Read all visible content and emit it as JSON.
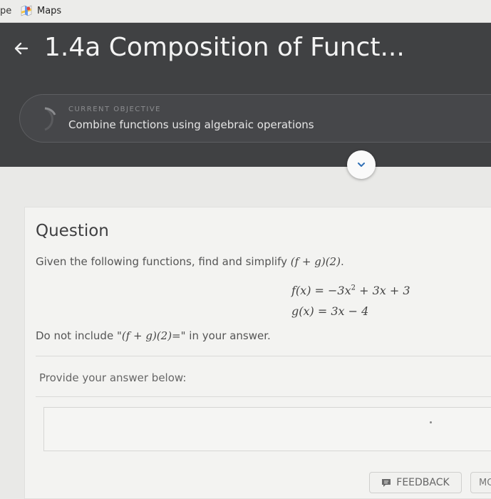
{
  "bookmarks": {
    "prev_label": "pe",
    "maps_label": "Maps"
  },
  "header": {
    "title": "1.4a Composition of Funct..."
  },
  "objective": {
    "label": "CURRENT OBJECTIVE",
    "text": "Combine functions using algebraic operations"
  },
  "question": {
    "heading": "Question",
    "prompt_pre": "Given the following functions, find and simplify ",
    "prompt_math": "(f + g)(2)",
    "prompt_post": ".",
    "eq1_lhs": "f(x) = −3x",
    "eq1_exp": "2",
    "eq1_rhs": " + 3x + 3",
    "eq2": "g(x) = 3x − 4",
    "note_pre": "Do not include \"",
    "note_math": "(f + g)(2)=",
    "note_post": "\" in your answer.",
    "answer_label": "Provide your answer below:"
  },
  "footer": {
    "feedback_label": "FEEDBACK",
    "more_label": "MORE"
  }
}
